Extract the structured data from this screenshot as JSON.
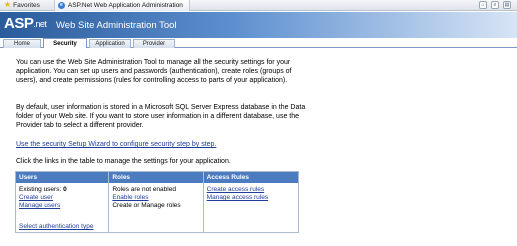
{
  "browser": {
    "favorites_label": "Favorites",
    "tab_title": "ASP.Net Web Application Administration"
  },
  "header": {
    "logo_text": "ASP",
    "logo_suffix": "net",
    "title": "Web Site Administration Tool"
  },
  "tabs": [
    {
      "label": "Home",
      "active": false
    },
    {
      "label": "Security",
      "active": true
    },
    {
      "label": "Application",
      "active": false
    },
    {
      "label": "Provider",
      "active": false
    }
  ],
  "content": {
    "intro": "You can use the Web Site Administration Tool to manage all the security settings for your application. You can set up users and passwords (authentication), create roles (groups of users), and create permissions (rules for controlling access to parts of your application).",
    "storage_info": "By default, user information is stored in a Microsoft SQL Server Express database in the Data folder of your Web site. If you want to store user information in a different database, use the Provider tab to select a different provider.",
    "wizard_link": "Use the security Setup Wizard to configure security step by step.",
    "table_intro": "Click the links in the table to manage the settings for your application."
  },
  "table": {
    "users": {
      "header": "Users",
      "existing_label": "Existing users: ",
      "existing_count": "0",
      "create_link": "Create user",
      "manage_link": "Manage users",
      "auth_link": "Select authentication type"
    },
    "roles": {
      "header": "Roles",
      "status": "Roles are not enabled",
      "enable_link": "Enable roles",
      "manage_text": "Create or Manage roles"
    },
    "access": {
      "header": "Access Rules",
      "create_link": "Create access rules",
      "manage_link": "Manage access rules"
    }
  }
}
